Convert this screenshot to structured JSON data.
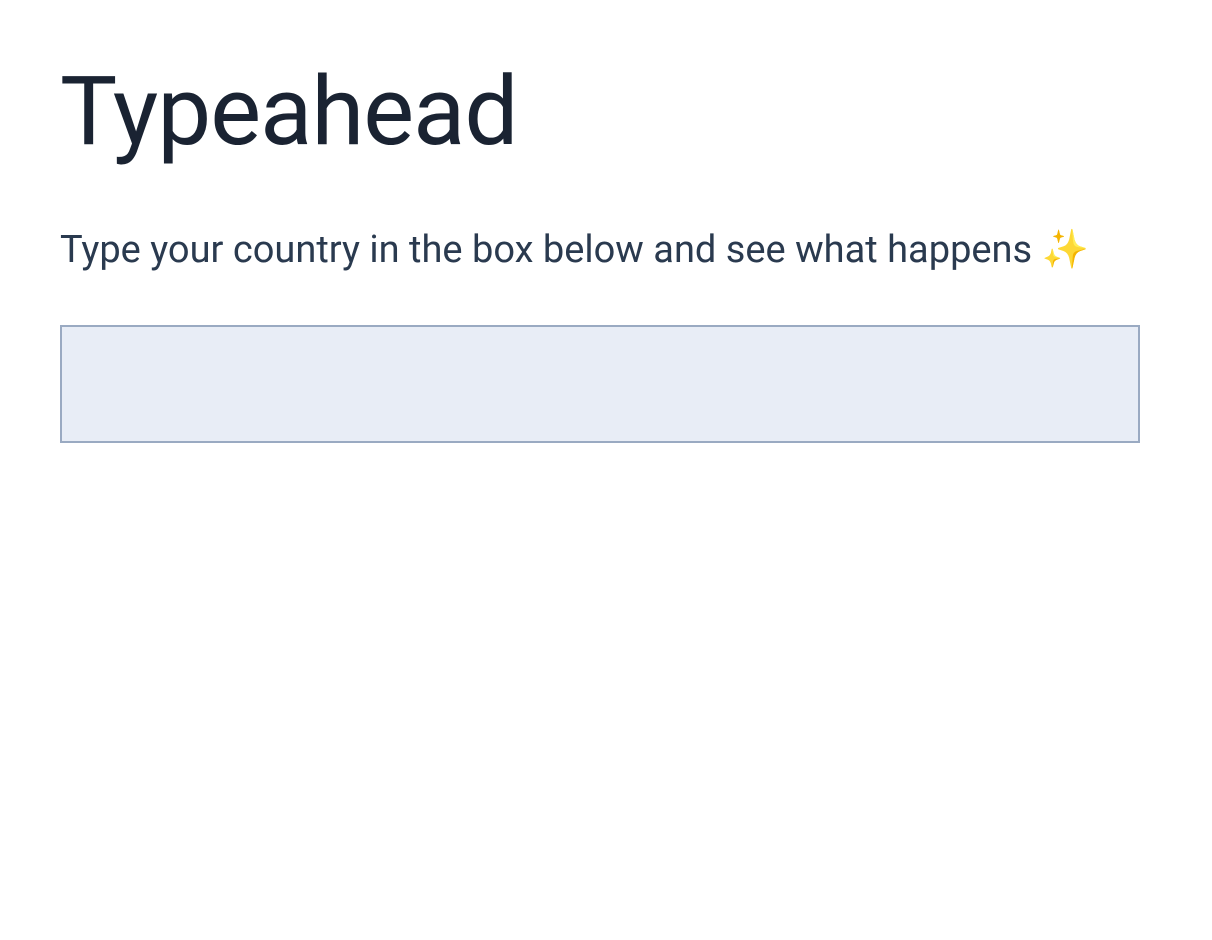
{
  "header": {
    "title": "Typeahead",
    "subtitle": "Type your country in the box below and see what happens ",
    "sparkle_emoji": "✨"
  },
  "form": {
    "country_input": {
      "value": "",
      "placeholder": ""
    }
  }
}
